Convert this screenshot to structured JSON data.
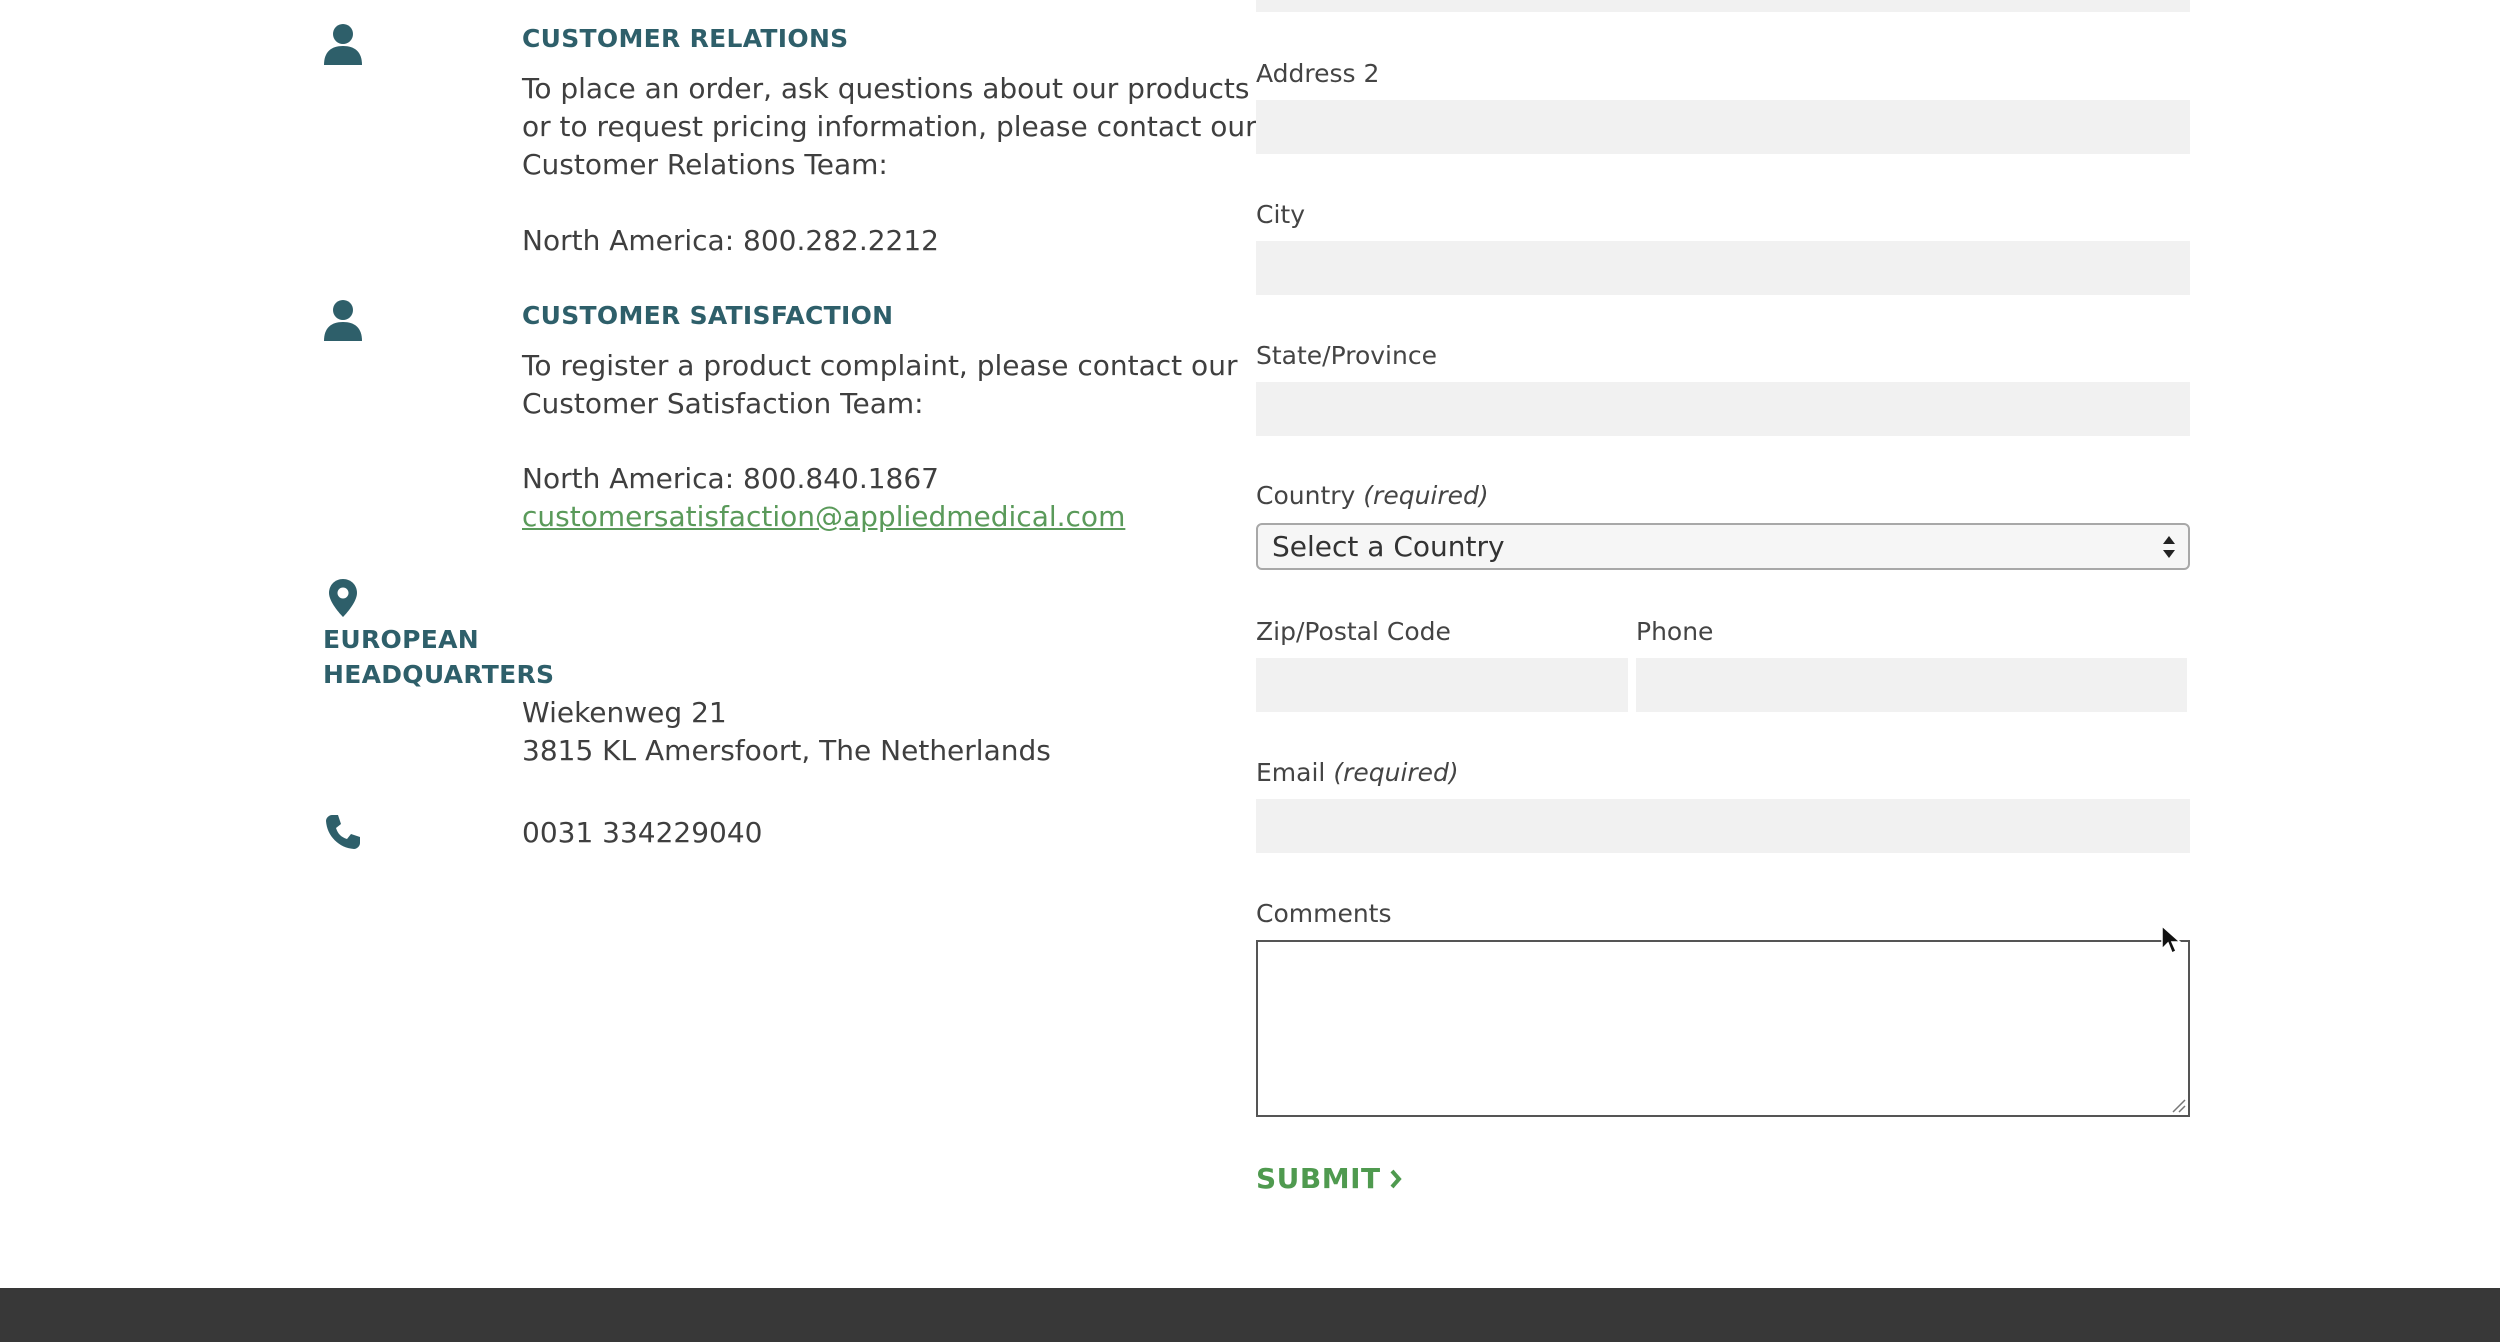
{
  "contact": {
    "customer_relations": {
      "heading": "CUSTOMER RELATIONS",
      "body_lines": [
        "To place an order, ask questions about our products",
        "or to request pricing information, please contact our",
        "Customer Relations Team:"
      ],
      "phone_line": "North America: 800.282.2212",
      "icon": "person-icon"
    },
    "customer_satisfaction": {
      "heading": "CUSTOMER SATISFACTION",
      "body_lines": [
        "To register a product complaint, please contact our",
        "Customer Satisfaction Team:"
      ],
      "phone_line": "North America: 800.840.1867",
      "email": "customersatisfaction@appliedmedical.com",
      "icon": "person-icon"
    },
    "european_hq": {
      "heading_lines": [
        "EUROPEAN",
        "HEADQUARTERS"
      ],
      "address_lines": [
        "Wiekenweg 21",
        "3815 KL Amersfoort, The Netherlands"
      ],
      "icon": "map-pin-icon"
    },
    "phone": {
      "number": "0031 334229040",
      "icon": "phone-icon"
    }
  },
  "form": {
    "address2": {
      "label": "Address 2",
      "value": ""
    },
    "city": {
      "label": "City",
      "value": ""
    },
    "state": {
      "label": "State/Province",
      "value": ""
    },
    "country": {
      "label": "Country",
      "required_note": "(required)",
      "selected": "Select a Country"
    },
    "zip": {
      "label": "Zip/Postal Code",
      "value": ""
    },
    "phone": {
      "label": "Phone",
      "value": ""
    },
    "email": {
      "label": "Email",
      "required_note": "(required)",
      "value": ""
    },
    "comments": {
      "label": "Comments",
      "value": ""
    },
    "submit_label": "SUBMIT"
  },
  "colors": {
    "accent_teal": "#2e5f6a",
    "link_green": "#5a9a5a",
    "submit_green": "#4f9a4f",
    "input_bg": "#f1f1f1",
    "footer_bg": "#383838"
  }
}
